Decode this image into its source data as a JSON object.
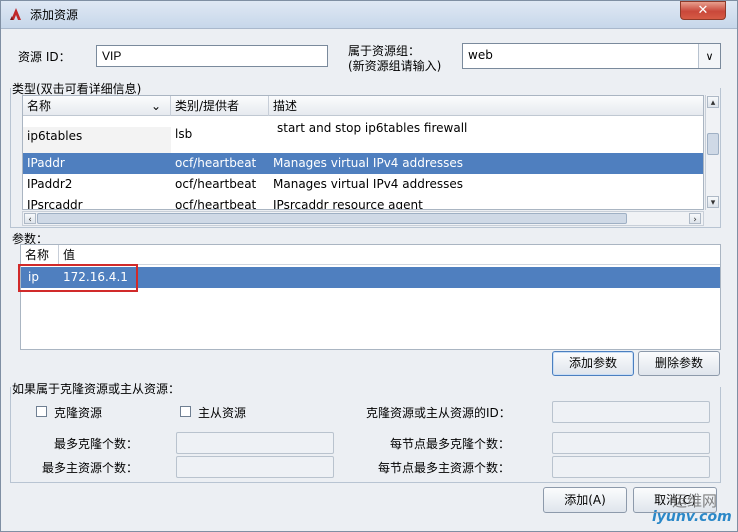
{
  "window": {
    "title": "添加资源",
    "close_label": "✕"
  },
  "resource_id": {
    "label": "资源 ID：",
    "value": "VIP"
  },
  "group": {
    "label_line1": "属于资源组：",
    "label_line2": "(新资源组请输入)",
    "value": "web"
  },
  "type_section": {
    "label": "类型(双击可看详细信息)",
    "columns": [
      "名称",
      "类别/提供者",
      "描述"
    ],
    "rows": [
      {
        "name": "ip6tables",
        "provider": "lsb",
        "description": "start and stop ip6tables firewall"
      },
      {
        "name": "IPaddr",
        "provider": "ocf/heartbeat",
        "description": "Manages virtual IPv4 addresses"
      },
      {
        "name": "IPaddr2",
        "provider": "ocf/heartbeat",
        "description": "Manages virtual IPv4 addresses"
      },
      {
        "name": "IPsrcaddr",
        "provider": "ocf/heartbeat",
        "description": "IPsrcaddr resource agent"
      }
    ]
  },
  "params_section": {
    "label": "参数：",
    "columns": [
      "名称",
      "值"
    ],
    "rows": [
      {
        "name": "ip",
        "value": "172.16.4.1"
      }
    ],
    "add_button": "添加参数",
    "delete_button": "删除参数"
  },
  "clone_section": {
    "label": "如果属于克隆资源或主从资源：",
    "clone_checkbox": "克隆资源",
    "master_checkbox": "主从资源",
    "clone_or_master_id": "克隆资源或主从资源的ID：",
    "max_clone": "最多克隆个数：",
    "max_master": "最多主资源个数：",
    "node_max_clone": "每节点最多克隆个数：",
    "node_max_master": "每节点最多主资源个数："
  },
  "footer": {
    "add_button": "添加(A)",
    "cancel_button": "取消(C)"
  },
  "watermark": {
    "line1": "运维网",
    "line2": "iyunv.com"
  },
  "colors": {
    "selection": "#4f7fbf",
    "highlight_box": "#d12a2a"
  }
}
